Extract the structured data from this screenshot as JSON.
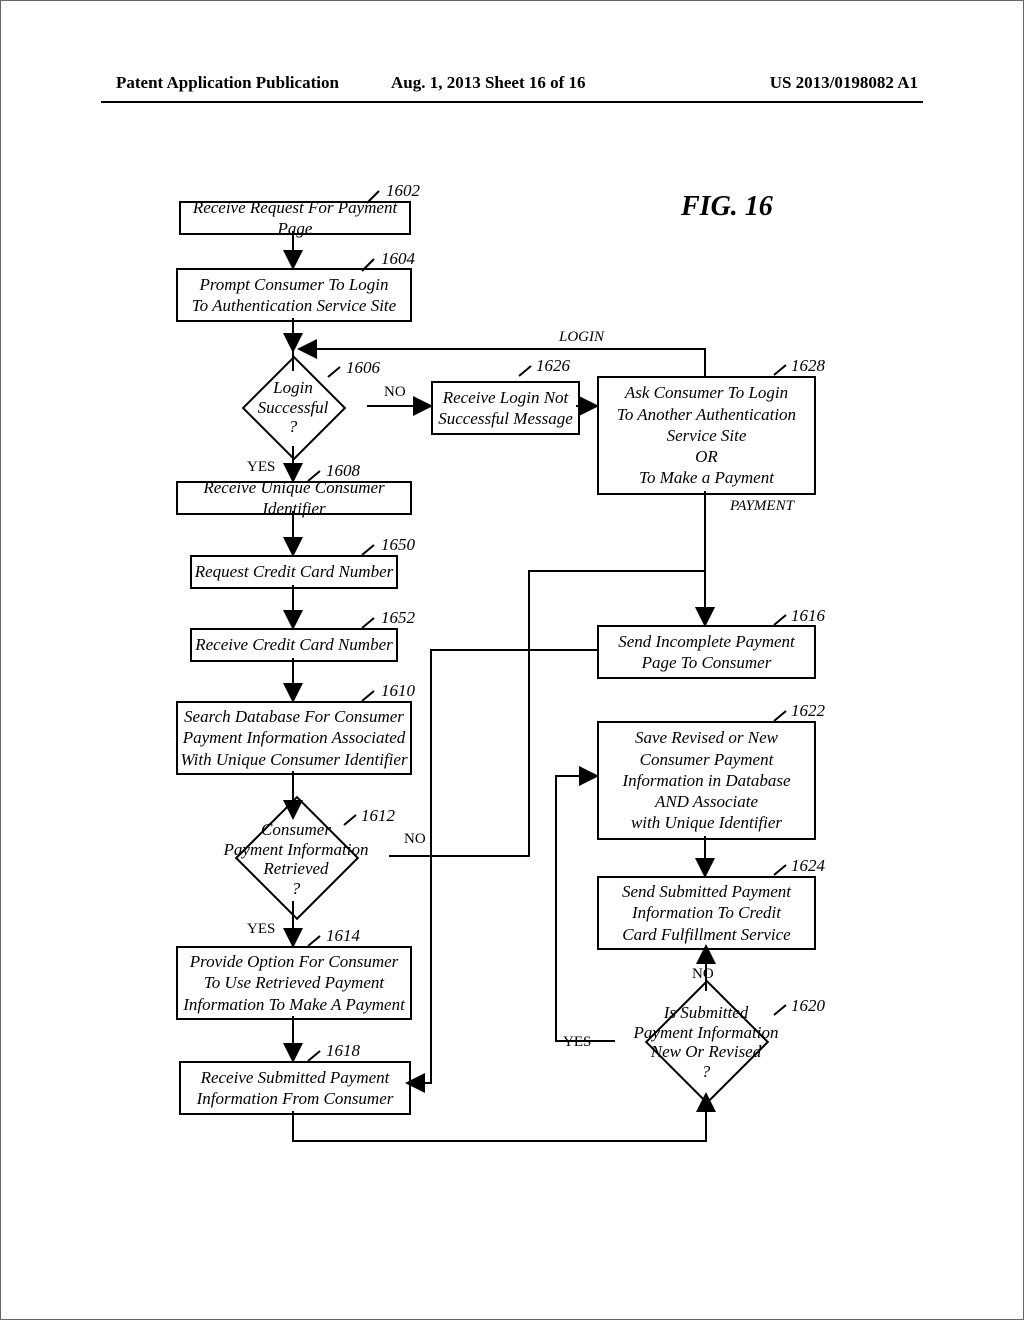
{
  "header": {
    "left": "Patent Application Publication",
    "center": "Aug. 1, 2013  Sheet 16 of 16",
    "right": "US 2013/0198082 A1"
  },
  "fig": "FIG. 16",
  "labels": {
    "yes": "YES",
    "no": "NO",
    "login": "LOGIN",
    "payment": "PAYMENT"
  },
  "ref": {
    "n1602": "1602",
    "n1604": "1604",
    "n1606": "1606",
    "n1608": "1608",
    "n1610": "1610",
    "n1612": "1612",
    "n1614": "1614",
    "n1616": "1616",
    "n1618": "1618",
    "n1620": "1620",
    "n1622": "1622",
    "n1624": "1624",
    "n1626": "1626",
    "n1628": "1628",
    "n1650": "1650",
    "n1652": "1652"
  },
  "boxes": {
    "b1602": "Receive Request For Payment Page",
    "b1604": "Prompt Consumer To Login\nTo Authentication Service Site",
    "b1608": "Receive Unique Consumer Identifier",
    "b1610": "Search Database For Consumer\nPayment Information Associated\nWith Unique Consumer Identifier",
    "b1614": "Provide Option For Consumer\nTo Use Retrieved Payment\nInformation To Make A Payment",
    "b1616": "Send Incomplete Payment\nPage To Consumer",
    "b1618": "Receive Submitted Payment\nInformation From Consumer",
    "b1622": "Save Revised or New\nConsumer Payment\nInformation in Database\nAND Associate\nwith Unique Identifier",
    "b1624": "Send Submitted Payment\nInformation To Credit\nCard Fulfillment Service",
    "b1626": "Receive Login Not\nSuccessful Message",
    "b1628": "Ask Consumer To Login\nTo Another Authentication\nService Site\nOR\nTo Make a Payment",
    "b1650": "Request Credit Card Number",
    "b1652": "Receive Credit Card Number"
  },
  "diamonds": {
    "d1606": "Login\nSuccessful\n?",
    "d1612": "Consumer\nPayment Information\nRetrieved\n?",
    "d1620": "Is Submitted\nPayment Information\nNew Or Revised\n?"
  }
}
